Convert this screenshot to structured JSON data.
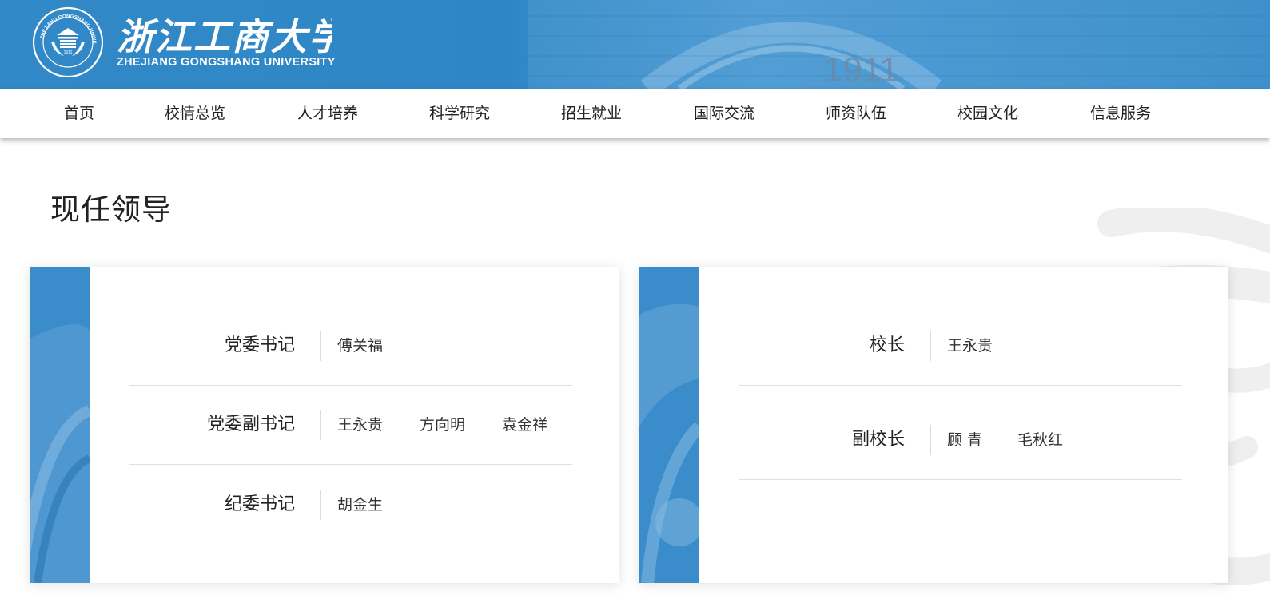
{
  "header": {
    "logo_name_cn": "浙江工商大学",
    "logo_name_en": "ZHEJIANG GONGSHANG UNIVERSITY",
    "seal_text": "ZHEJIANG GONGSHANG UNIVERSITY",
    "seal_year": "1911",
    "banner_year": "1911",
    "brand_color": "#2f86c6"
  },
  "nav": {
    "items": [
      {
        "label": "首页"
      },
      {
        "label": "校情总览"
      },
      {
        "label": "人才培养"
      },
      {
        "label": "科学研究"
      },
      {
        "label": "招生就业"
      },
      {
        "label": "国际交流"
      },
      {
        "label": "师资队伍"
      },
      {
        "label": "校园文化"
      },
      {
        "label": "信息服务"
      }
    ]
  },
  "page": {
    "title": "现任领导"
  },
  "party_card": {
    "rows": [
      {
        "role": "党委书记",
        "names": [
          "傅关福"
        ]
      },
      {
        "role": "党委副书记",
        "names": [
          "王永贵",
          "方向明",
          "袁金祥"
        ]
      },
      {
        "role": "纪委书记",
        "names": [
          "胡金生"
        ]
      }
    ]
  },
  "admin_card": {
    "rows": [
      {
        "role": "校长",
        "names": [
          "王永贵"
        ]
      },
      {
        "role": "副校长",
        "names": [
          "顾 青",
          "毛秋红"
        ]
      }
    ]
  }
}
